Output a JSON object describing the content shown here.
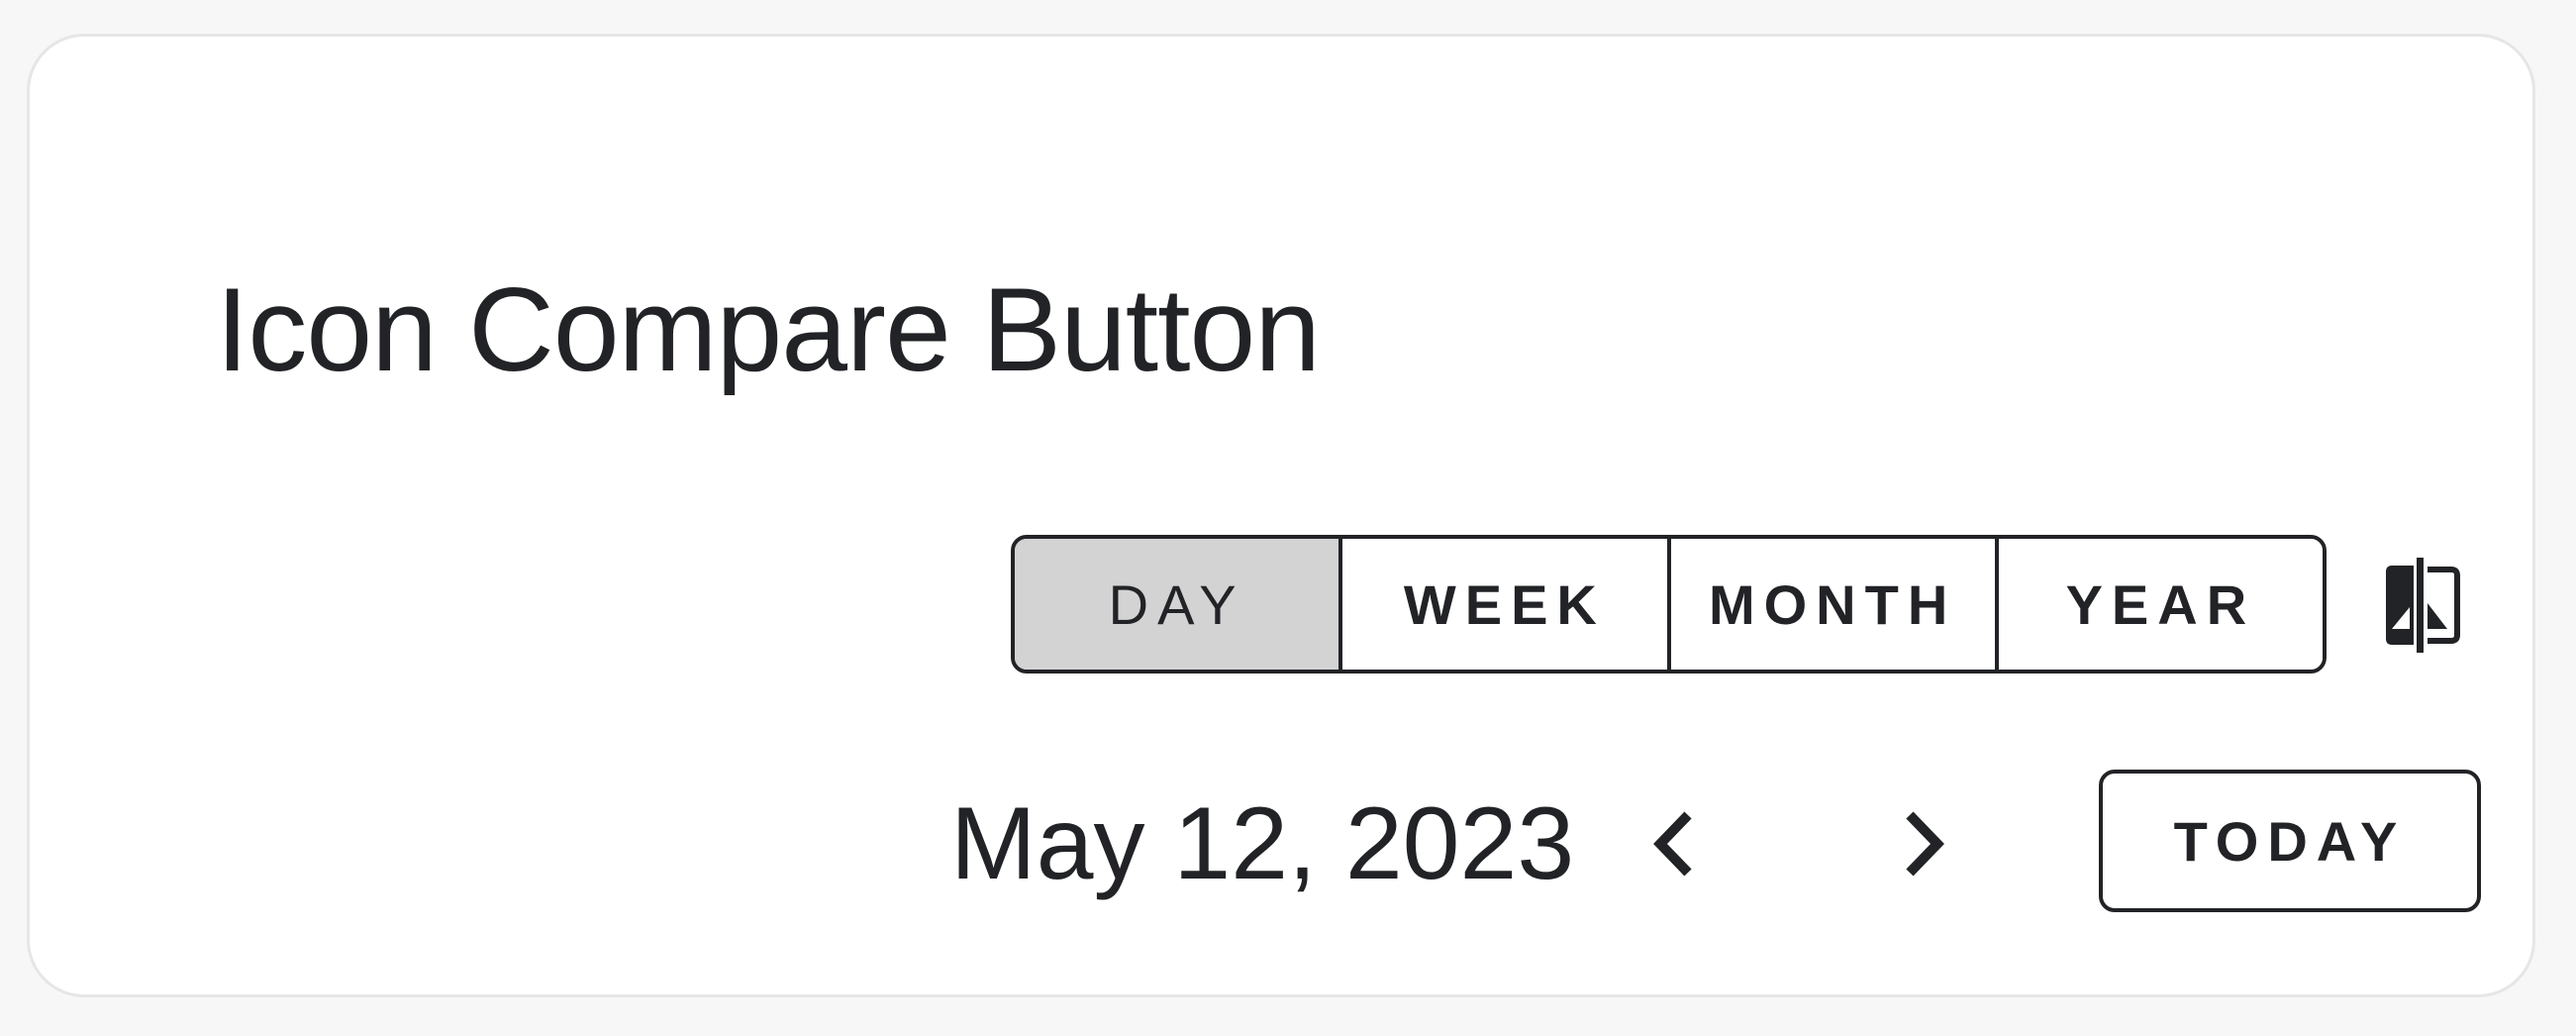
{
  "title": "Icon Compare Button",
  "view_switcher": {
    "options": [
      "DAY",
      "WEEK",
      "MONTH",
      "YEAR"
    ],
    "selected": "DAY"
  },
  "compare_button": {
    "icon": "compare-icon"
  },
  "date_navigation": {
    "current_date": "May 12, 2023",
    "prev_icon": "chevron-left-icon",
    "next_icon": "chevron-right-icon",
    "today_label": "TODAY"
  },
  "colors": {
    "text": "#222326",
    "selected_segment_bg": "#d2d3d2",
    "card_border": "#e6e6e6",
    "page_bg": "#f7f7f7"
  }
}
